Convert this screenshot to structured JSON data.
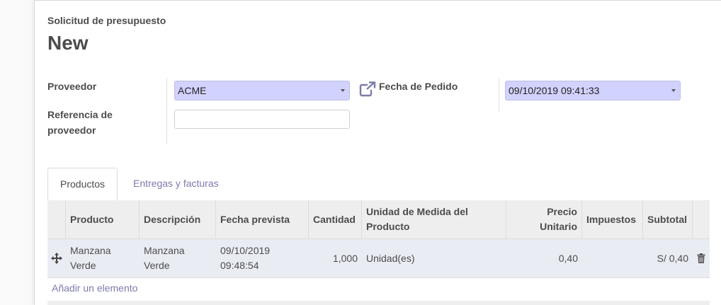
{
  "header": {
    "subtitle": "Solicitud de presupuesto",
    "title": "New"
  },
  "form": {
    "vendor_label": "Proveedor",
    "vendor_value": "ACME",
    "vendor_ref_label": "Referencia de proveedor",
    "vendor_ref_value": "",
    "order_date_label": "Fecha de Pedido",
    "order_date_value": "09/10/2019 09:41:33"
  },
  "tabs": [
    {
      "label": "Productos",
      "active": true
    },
    {
      "label": "Entregas y facturas",
      "active": false
    }
  ],
  "table": {
    "columns": [
      "Producto",
      "Descripción",
      "Fecha prevista",
      "Cantidad",
      "Unidad de Medida del Producto",
      "Precio Unitario",
      "Impuestos",
      "Subtotal"
    ],
    "rows": [
      {
        "product": "Manzana Verde",
        "description": "Manzana Verde",
        "scheduled_date": "09/10/2019 09:48:54",
        "quantity": "1,000",
        "uom": "Unidad(es)",
        "unit_price": "0,40",
        "taxes": "",
        "subtotal": "S/ 0,40"
      }
    ],
    "add_line_label": "Añadir un elemento"
  },
  "icons": [
    "external-link-icon",
    "drag-handle-icon",
    "trash-icon",
    "caret-down-icon"
  ],
  "colors": {
    "accent_link": "#7c7bad",
    "required_field_bg": "#d2d2ff",
    "row_highlight_bg": "#e9ecf3"
  }
}
